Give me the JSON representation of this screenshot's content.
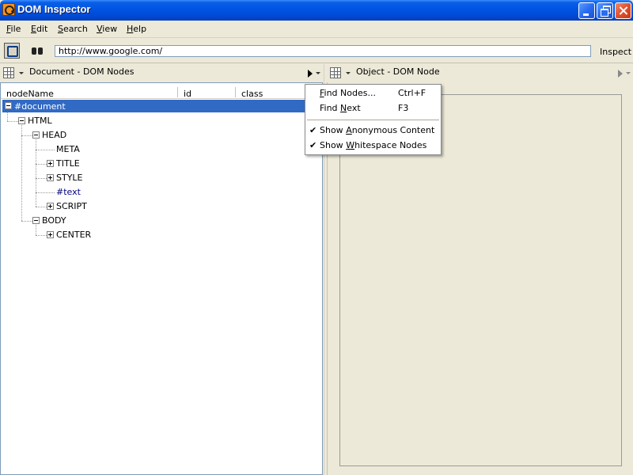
{
  "window": {
    "title": "DOM Inspector",
    "controls": [
      "minimize",
      "maximize",
      "close"
    ]
  },
  "menubar": {
    "items": [
      {
        "label": "File",
        "accel": "F"
      },
      {
        "label": "Edit",
        "accel": "E"
      },
      {
        "label": "Search",
        "accel": "S"
      },
      {
        "label": "View",
        "accel": "V"
      },
      {
        "label": "Help",
        "accel": "H"
      }
    ]
  },
  "toolbar": {
    "select_icon": "select-element-icon",
    "find_icon": "binoculars-icon",
    "url_value": "http://www.google.com/",
    "inspect_label": "Inspect"
  },
  "left_pane": {
    "title": "Document - DOM Nodes",
    "columns": [
      "nodeName",
      "id",
      "class"
    ],
    "tree": [
      {
        "label": "#document",
        "depth": 0,
        "expander": "minus",
        "selected": true
      },
      {
        "label": "HTML",
        "depth": 1,
        "expander": "minus"
      },
      {
        "label": "HEAD",
        "depth": 2,
        "expander": "minus"
      },
      {
        "label": "META",
        "depth": 3,
        "expander": "none"
      },
      {
        "label": "TITLE",
        "depth": 3,
        "expander": "plus"
      },
      {
        "label": "STYLE",
        "depth": 3,
        "expander": "plus"
      },
      {
        "label": "#text",
        "depth": 3,
        "expander": "none"
      },
      {
        "label": "SCRIPT",
        "depth": 3,
        "expander": "plus"
      },
      {
        "label": "BODY",
        "depth": 2,
        "expander": "minus"
      },
      {
        "label": "CENTER",
        "depth": 3,
        "expander": "plus"
      }
    ]
  },
  "right_pane": {
    "title": "Object - DOM Node"
  },
  "context_menu": {
    "items": [
      {
        "label": "Find Nodes...",
        "accel": "F",
        "shortcut": "Ctrl+F",
        "checked": false
      },
      {
        "label": "Find Next",
        "accel": "N",
        "shortcut": "F3",
        "checked": false
      },
      {
        "label": "Show Anonymous Content",
        "accel": "A",
        "shortcut": "",
        "checked": true
      },
      {
        "label": "Show Whitespace Nodes",
        "accel": "W",
        "shortcut": "",
        "checked": true
      }
    ]
  },
  "colors": {
    "titlebar": "#0054e3",
    "selection": "#316ac5",
    "chrome": "#ece9d8"
  }
}
